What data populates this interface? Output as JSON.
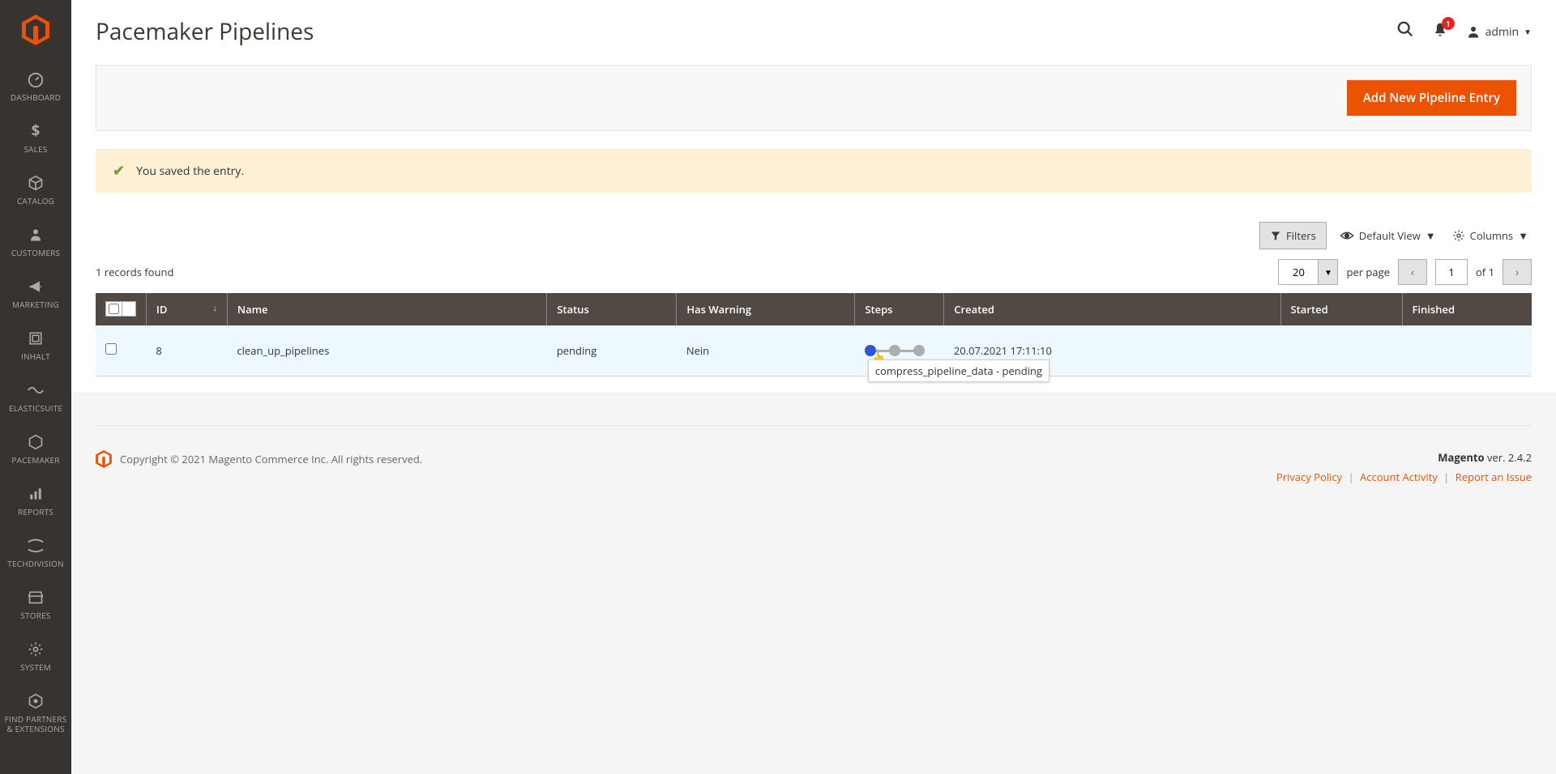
{
  "sidebar": [
    {
      "label": "DASHBOARD",
      "icon": "dashboard"
    },
    {
      "label": "SALES",
      "icon": "dollar"
    },
    {
      "label": "CATALOG",
      "icon": "box"
    },
    {
      "label": "CUSTOMERS",
      "icon": "person"
    },
    {
      "label": "MARKETING",
      "icon": "megaphone"
    },
    {
      "label": "INHALT",
      "icon": "blocks"
    },
    {
      "label": "ELASTICSUITE",
      "icon": "elastic"
    },
    {
      "label": "PACEMAKER",
      "icon": "hex"
    },
    {
      "label": "REPORTS",
      "icon": "chart"
    },
    {
      "label": "TECHDIVISION",
      "icon": "td"
    },
    {
      "label": "STORES",
      "icon": "stores"
    },
    {
      "label": "SYSTEM",
      "icon": "gear"
    },
    {
      "label": "FIND PARTNERS & EXTENSIONS",
      "icon": "puzzle"
    }
  ],
  "page_title": "Pacemaker Pipelines",
  "header": {
    "notif_count": "1",
    "admin_label": "admin"
  },
  "action": {
    "add_label": "Add New Pipeline Entry"
  },
  "message": {
    "text": "You saved the entry."
  },
  "toolbar": {
    "filters_label": "Filters",
    "default_view_label": "Default View",
    "columns_label": "Columns",
    "records_found": "1 records found",
    "page_size": "20",
    "per_page": "per page",
    "page_current": "1",
    "page_total_prefix": "of",
    "page_total": "1"
  },
  "columns": {
    "id": "ID",
    "name": "Name",
    "status": "Status",
    "has_warning": "Has Warning",
    "steps": "Steps",
    "created": "Created",
    "started": "Started",
    "finished": "Finished"
  },
  "row": {
    "id": "8",
    "name": "clean_up_pipelines",
    "status": "pending",
    "has_warning": "Nein",
    "created": "20.07.2021 17:11:10",
    "started": "",
    "finished": "",
    "tooltip": "compress_pipeline_data - pending"
  },
  "footer": {
    "copyright": "Copyright © 2021 Magento Commerce Inc. All rights reserved.",
    "version_label": "Magento",
    "version": "ver. 2.4.2",
    "privacy": "Privacy Policy",
    "activity": "Account Activity",
    "report": "Report an Issue"
  }
}
